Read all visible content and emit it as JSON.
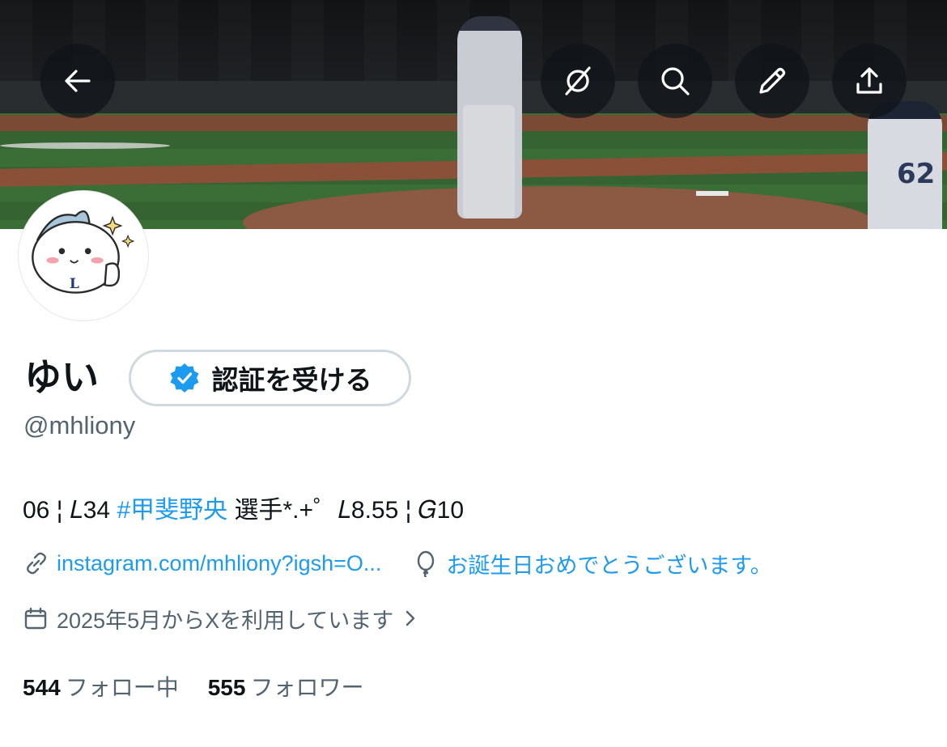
{
  "profile": {
    "display_name": "ゆい",
    "verify_button_label": "認証を受ける",
    "handle": "@mhliony",
    "bio": {
      "prefix": "06 ¦ 𝐿34 ",
      "hashtag": "#甲斐野央",
      "suffix": " 選手*.+゜𝐿8.55 ¦ 𝐺10"
    },
    "link": "instagram.com/mhliony?igsh=O...",
    "birthday": "お誕生日おめでとうございます。",
    "joined": "2025年5月からXを利用しています",
    "following_count": "544",
    "following_label": "フォロー中",
    "followers_count": "555",
    "followers_label": "フォロワー"
  },
  "banner": {
    "jersey_number": "62"
  },
  "icons": {
    "back": "arrow-left-icon",
    "grok": "grok-icon",
    "search": "search-icon",
    "edit": "pencil-icon",
    "share": "share-icon",
    "verified": "verified-badge-icon",
    "link": "link-icon",
    "birthday": "balloon-icon",
    "calendar": "calendar-icon",
    "chevron": "chevron-right-icon"
  },
  "colors": {
    "accent": "#1d9bf0",
    "text_primary": "#0f1419",
    "text_secondary": "#536471",
    "border": "#cfd9de"
  }
}
